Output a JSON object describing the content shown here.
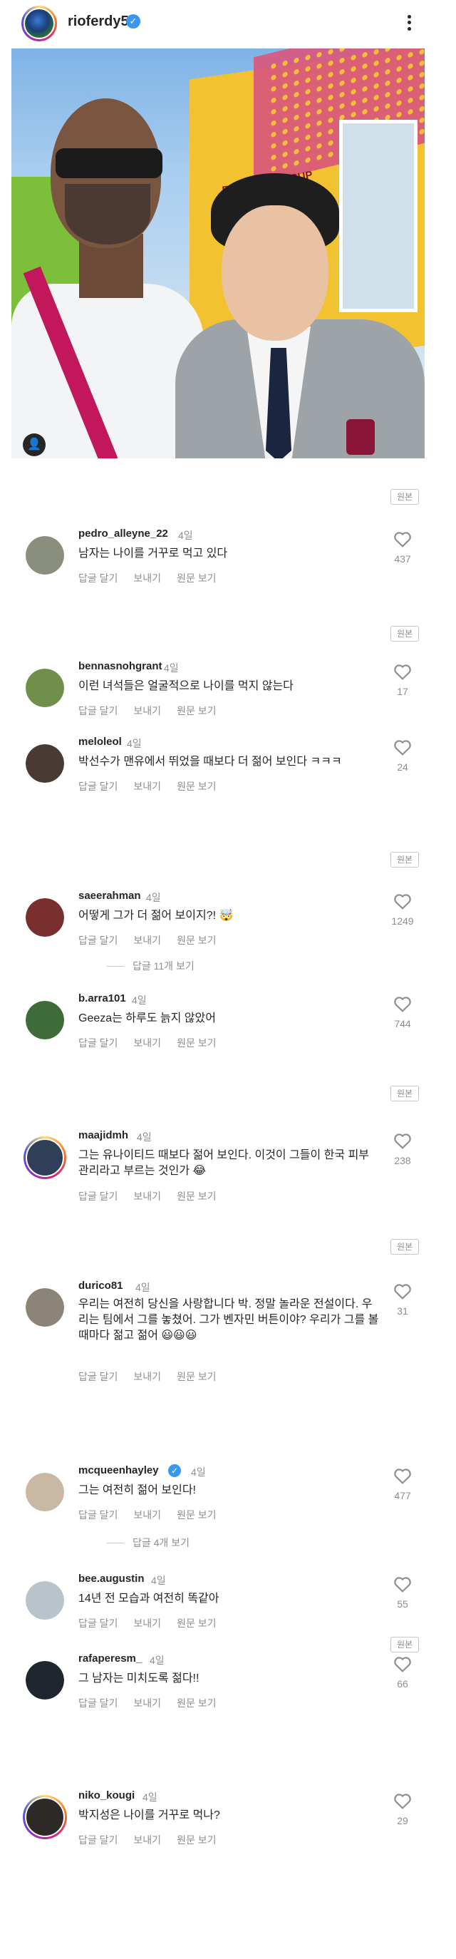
{
  "post": {
    "username": "rioferdy5",
    "verified_icon": "verified-icon",
    "more_icon": "more-vertical-icon",
    "photo_alt": "",
    "tag_icon": "user-tag-icon",
    "photo_banner": "FIFA WORLD CUP"
  },
  "ui": {
    "origin_label": "원본",
    "reply": "답글 달기",
    "send": "보내기",
    "view_original": "원문 보기",
    "heart_icon": "heart-outline-icon"
  },
  "comments": [
    {
      "username": "pedro_alleyne_22",
      "time": "4일",
      "text": "남자는 나이를 거꾸로 먹고 있다",
      "likes": "437",
      "avatar_color": "#8a8f7d"
    },
    {
      "username": "bennasnohgrant",
      "time": "4일",
      "text": "이런 녀석들은 얼굴적으로 나이를 먹지 않는다",
      "likes": "17",
      "avatar_color": "#6f8f4a"
    },
    {
      "username": "meloleol",
      "time": "4일",
      "text": "박선수가 맨유에서 뛰었을 때보다 더 젊어 보인다 ㅋㅋㅋ",
      "likes": "24",
      "avatar_color": "#4a3a34"
    },
    {
      "username": "saeerahman",
      "time": "4일",
      "text": "어떻게 그가 더 젊어 보이지?! 🤯",
      "likes": "1249",
      "avatar_color": "#7a2f2f"
    },
    {
      "username": "b.arra101",
      "time": "4일",
      "text": "Geeza는 하루도 늙지 않았어",
      "likes": "744",
      "avatar_color": "#3f6b3a"
    },
    {
      "username": "maajidmh",
      "time": "4일",
      "text": "그는 유나이티드 때보다 젊어 보인다. 이것이 그들이 한국 피부 관리라고 부르는 것인가 😂",
      "likes": "238",
      "avatar_color": "#2f3f57"
    },
    {
      "username": "durico81",
      "time": "4일",
      "text": "우리는 여전히 당신을 사랑합니다 박. 정말 놀라운 전설이다. 우리는 팀에서 그를 놓쳤어. 그가 벤자민 버튼이야? 우리가 그를 볼 때마다 젊고 젊어 😃😃😃",
      "likes": "31",
      "avatar_color": "#8c8478"
    },
    {
      "username": "mcqueenhayley",
      "time": "4일",
      "text": "그는 여전히 젊어 보인다!",
      "likes": "477",
      "avatar_color": "#c9b9a4"
    },
    {
      "username": "bee.augustin",
      "time": "4일",
      "text": "14년 전 모습과 여전히 똑같아",
      "likes": "55",
      "avatar_color": "#b9c3cb"
    },
    {
      "username": "rafaperesm_",
      "time": "4일",
      "text": "그 남자는 미치도록 젊다!!",
      "likes": "66",
      "avatar_color": "#1f2630"
    },
    {
      "username": "niko_kougi",
      "time": "4일",
      "text": "박지성은 나이를 거꾸로 먹나?",
      "likes": "29",
      "avatar_color": "#2e2a2a"
    }
  ],
  "replies": {
    "saeerahman": "답글 11개 보기",
    "mcqueenhayley": "답글 4개 보기"
  }
}
